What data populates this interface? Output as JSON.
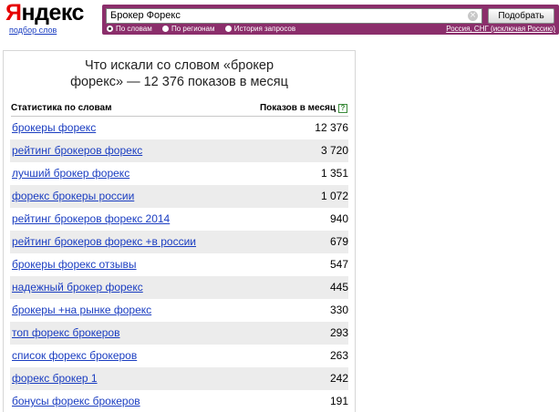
{
  "header": {
    "logo_first": "Я",
    "logo_rest": "ндекс",
    "logo_sub": "подбор слов"
  },
  "search": {
    "query": "Брокер Форекс",
    "submit_label": "Подобрать",
    "modes": [
      {
        "label": "По словам",
        "selected": true
      },
      {
        "label": "По регионам",
        "selected": false
      },
      {
        "label": "История запросов",
        "selected": false
      }
    ],
    "region": "Россия, СНГ (исключая Россию)",
    "accent_color": "#8b2e6b"
  },
  "panel": {
    "title": "Что искали со словом «брокер форекс» — 12 376 показов в месяц",
    "col_left": "Статистика по словам",
    "col_right": "Показов в месяц",
    "help_symbol": "?"
  },
  "rows": [
    {
      "keyword": "брокеры форекс",
      "count": "12 376"
    },
    {
      "keyword": "рейтинг брокеров форекс",
      "count": "3 720"
    },
    {
      "keyword": "лучший брокер форекс",
      "count": "1 351"
    },
    {
      "keyword": "форекс брокеры россии",
      "count": "1 072"
    },
    {
      "keyword": "рейтинг брокеров форекс 2014",
      "count": "940"
    },
    {
      "keyword": "рейтинг брокеров форекс +в россии",
      "count": "679"
    },
    {
      "keyword": "брокеры форекс отзывы",
      "count": "547"
    },
    {
      "keyword": "надежный брокер форекс",
      "count": "445"
    },
    {
      "keyword": "брокеры +на рынке форекс",
      "count": "330"
    },
    {
      "keyword": "топ форекс брокеров",
      "count": "293"
    },
    {
      "keyword": "список форекс брокеров",
      "count": "263"
    },
    {
      "keyword": "форекс брокер 1",
      "count": "242"
    },
    {
      "keyword": "бонусы форекс брокеров",
      "count": "191"
    }
  ]
}
